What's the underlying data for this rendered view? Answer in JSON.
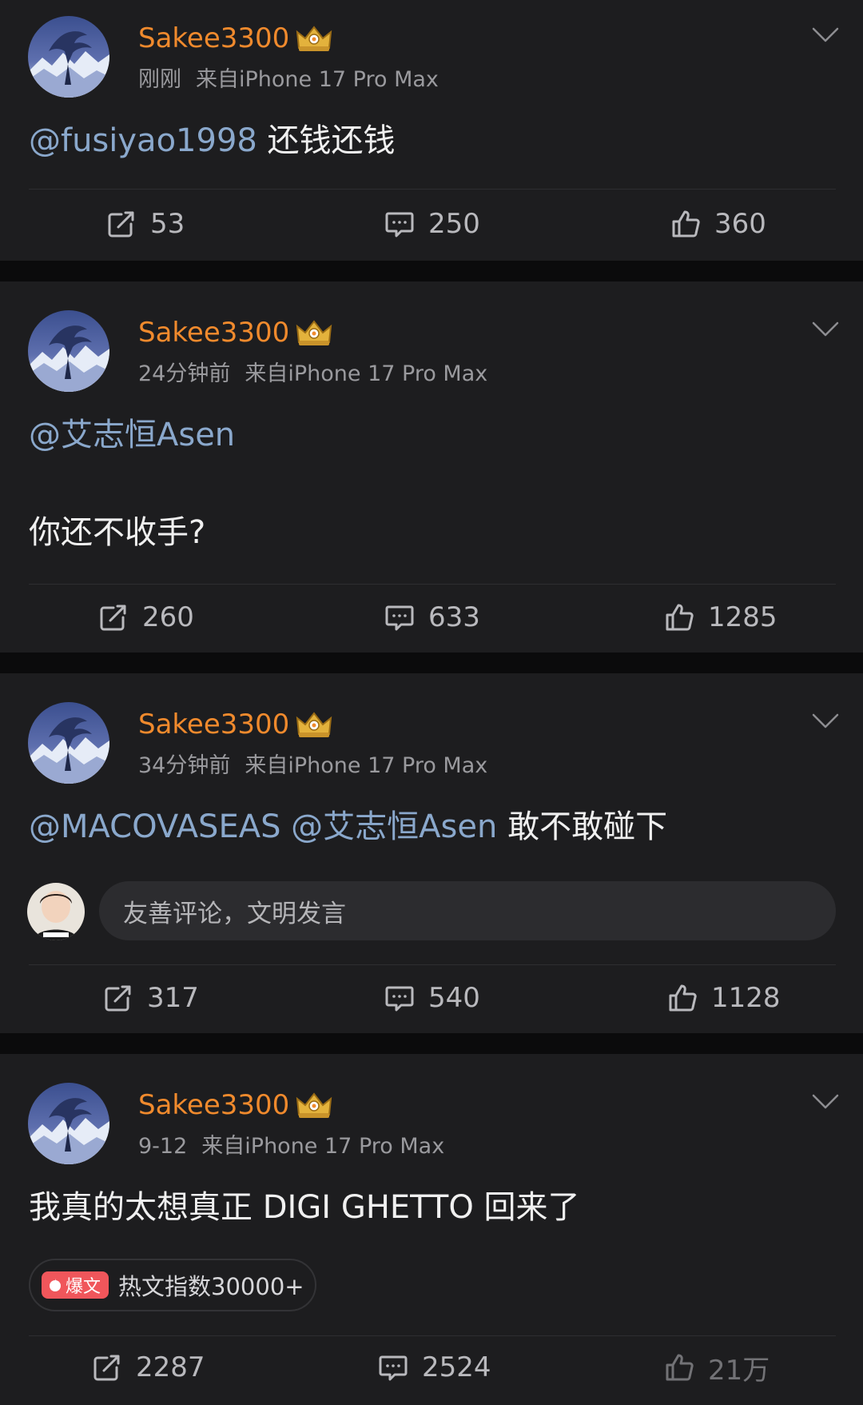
{
  "posts": [
    {
      "username": "Sakee3300",
      "time": "刚刚",
      "source": "来自iPhone 17 Pro Max",
      "text_mention": "@fusiyao1998",
      "text_body": " 还钱还钱",
      "repost_count": "53",
      "comment_count": "250",
      "like_count": "360"
    },
    {
      "username": "Sakee3300",
      "time": "24分钟前",
      "source": "来自iPhone 17 Pro Max",
      "text_mention": "@艾志恒Asen",
      "text_line2": "你还不收手?",
      "repost_count": "260",
      "comment_count": "633",
      "like_count": "1285"
    },
    {
      "username": "Sakee3300",
      "time": "34分钟前",
      "source": "来自iPhone 17 Pro Max",
      "text_mention": "@MACOVASEAS @艾志恒Asen",
      "text_body": " 敢不敢碰下",
      "comment_placeholder": "友善评论，文明发言",
      "repost_count": "317",
      "comment_count": "540",
      "like_count": "1128"
    },
    {
      "username": "Sakee3300",
      "time": "9-12",
      "source": "来自iPhone 17 Pro Max",
      "text_body": "我真的太想真正 DIGI GHETTO 回来了",
      "hot_tag": "爆文",
      "hot_text": "热文指数30000+",
      "repost_count": "2287",
      "comment_count": "2524",
      "like_count": "21万"
    }
  ],
  "icons": {
    "crown": "crown-badge-icon",
    "chevron": "chevron-down-icon",
    "repost": "repost-icon",
    "comment": "comment-icon",
    "like": "thumbs-up-icon"
  },
  "colors": {
    "background": "#1d1d1f",
    "separator": "#0b0b0c",
    "username": "#f08a2d",
    "mention": "#8aa8cc",
    "hot_tag": "#f0565b"
  }
}
